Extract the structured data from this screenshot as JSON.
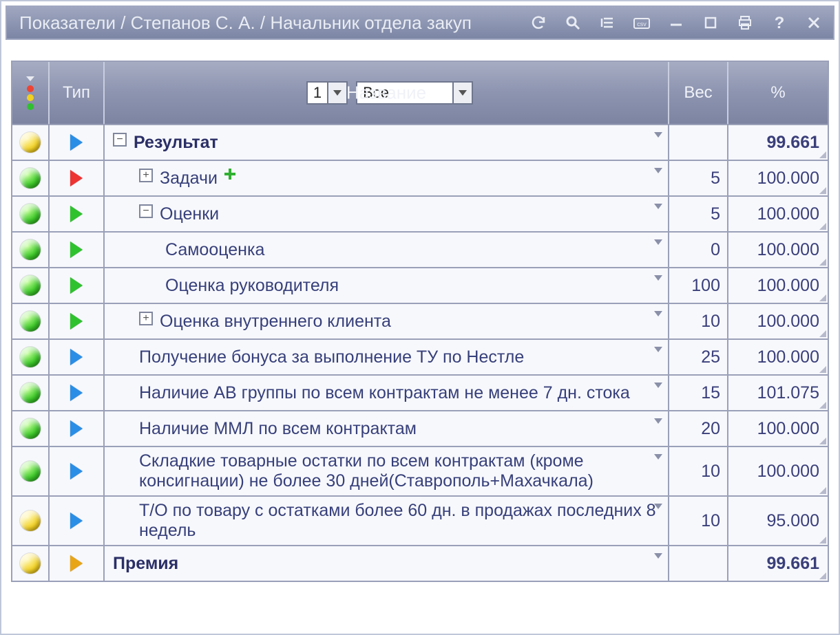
{
  "titlebar": {
    "title": "Показатели / Степанов С. А. / Начальник отдела закуп"
  },
  "header": {
    "type_label": "Тип",
    "level_value": "1",
    "filter_value": "Все",
    "name_label": "Название",
    "weight_label": "Вес",
    "pct_label": "%"
  },
  "rows": [
    {
      "status": "yellow",
      "type": "blue",
      "indent": 0,
      "expand": "minus",
      "name": "Результат",
      "bold": true,
      "add": false,
      "weight": "",
      "pct": "99.661"
    },
    {
      "status": "green",
      "type": "red",
      "indent": 1,
      "expand": "plus",
      "name": "Задачи",
      "bold": false,
      "add": true,
      "weight": "5",
      "pct": "100.000"
    },
    {
      "status": "green",
      "type": "green",
      "indent": 1,
      "expand": "minus",
      "name": "Оценки",
      "bold": false,
      "add": false,
      "weight": "5",
      "pct": "100.000"
    },
    {
      "status": "green",
      "type": "green",
      "indent": 2,
      "expand": "",
      "name": "Самооценка",
      "bold": false,
      "add": false,
      "weight": "0",
      "pct": "100.000"
    },
    {
      "status": "green",
      "type": "green",
      "indent": 2,
      "expand": "",
      "name": "Оценка руководителя",
      "bold": false,
      "add": false,
      "weight": "100",
      "pct": "100.000"
    },
    {
      "status": "green",
      "type": "green",
      "indent": 1,
      "expand": "plus",
      "name": "Оценка внутреннего клиента",
      "bold": false,
      "add": false,
      "weight": "10",
      "pct": "100.000"
    },
    {
      "status": "green",
      "type": "blue",
      "indent": 1,
      "expand": "",
      "name": "Получение бонуса за выполнение ТУ по Нестле",
      "bold": false,
      "add": false,
      "weight": "25",
      "pct": "100.000"
    },
    {
      "status": "green",
      "type": "blue",
      "indent": 1,
      "expand": "",
      "name": "Наличие АВ группы по всем контрактам не менее 7 дн. стока",
      "bold": false,
      "add": false,
      "weight": "15",
      "pct": "101.075"
    },
    {
      "status": "green",
      "type": "blue",
      "indent": 1,
      "expand": "",
      "name": "Наличие ММЛ по всем контрактам",
      "bold": false,
      "add": false,
      "weight": "20",
      "pct": "100.000"
    },
    {
      "status": "green",
      "type": "blue",
      "indent": 1,
      "expand": "",
      "name": "Складкие товарные остатки по всем контрактам (кроме консигнации) не более 30 дней(Ставрополь+Махачкала)",
      "bold": false,
      "add": false,
      "weight": "10",
      "pct": "100.000"
    },
    {
      "status": "yellow",
      "type": "blue",
      "indent": 1,
      "expand": "",
      "name": "Т/О по товару с остатками более 60 дн. в продажах последних 8 недель",
      "bold": false,
      "add": false,
      "weight": "10",
      "pct": "95.000"
    },
    {
      "status": "yellow",
      "type": "orange",
      "indent": 0,
      "expand": "",
      "name": "Премия",
      "bold": true,
      "add": false,
      "weight": "",
      "pct": "99.661"
    }
  ]
}
